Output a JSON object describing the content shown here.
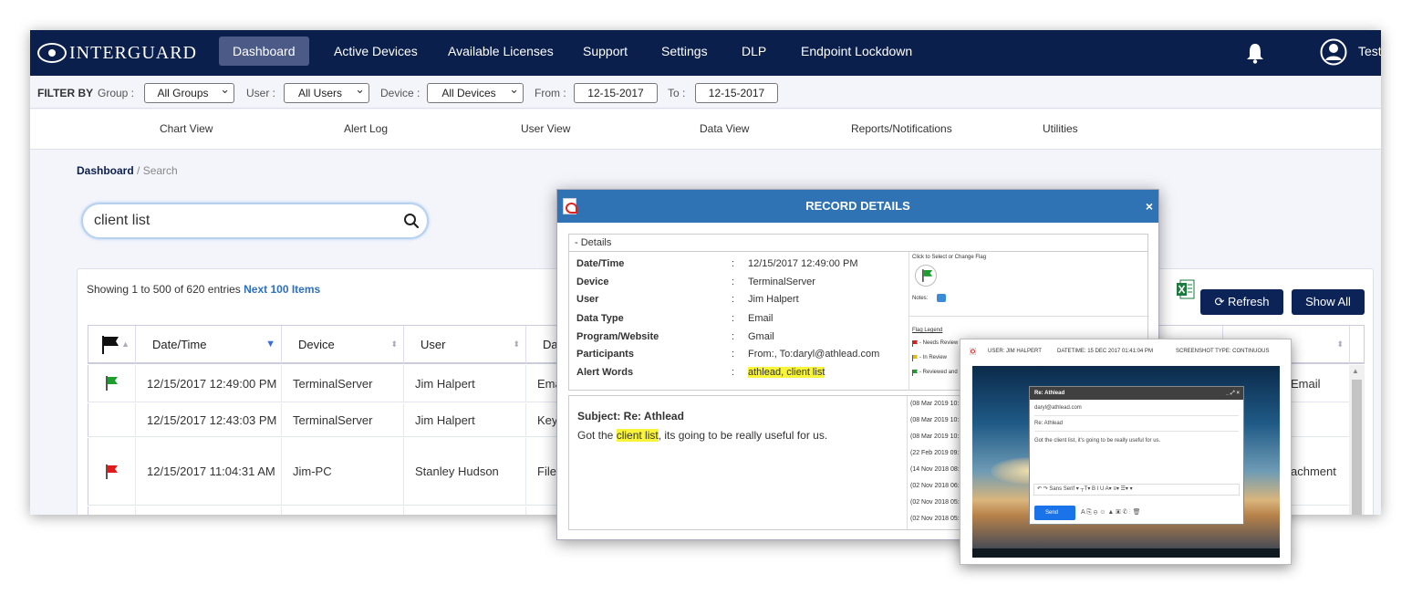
{
  "brand": {
    "name": "INTERGUARD"
  },
  "nav": {
    "items": [
      "Dashboard",
      "Active Devices",
      "Available Licenses",
      "Support",
      "Settings",
      "DLP",
      "Endpoint Lockdown"
    ],
    "user": "Test"
  },
  "filter": {
    "title": "FILTER BY",
    "group_label": "Group :",
    "group_value": "All Groups",
    "user_label": "User :",
    "user_value": "All Users",
    "device_label": "Device :",
    "device_value": "All Devices",
    "from_label": "From :",
    "from_value": "12-15-2017",
    "to_label": "To :",
    "to_value": "12-15-2017"
  },
  "subnav": [
    "Chart View",
    "Alert Log",
    "User View",
    "Data View",
    "Reports/Notifications",
    "Utilities"
  ],
  "breadcrumb": {
    "root": "Dashboard",
    "current": "/ Search"
  },
  "search": {
    "value": "client list"
  },
  "table": {
    "entries_text": "Showing 1 to 500 of 620 entries",
    "next_link": "Next 100 Items",
    "refresh": "Refresh",
    "show_all": "Show All",
    "headers": [
      "Date/Time",
      "Device",
      "User",
      "Dat"
    ],
    "rows": [
      {
        "flag": "green",
        "datetime": "12/15/2017 12:49:00 PM",
        "device": "TerminalServer",
        "user": "Jim Halpert",
        "type": "Ema",
        "extra": "Email"
      },
      {
        "flag": "none",
        "datetime": "12/15/2017 12:43:03 PM",
        "device": "TerminalServer",
        "user": "Jim Halpert",
        "type": "Keys",
        "extra": ""
      },
      {
        "flag": "red",
        "datetime": "12/15/2017 11:04:31 AM",
        "device": "Jim-PC",
        "user": "Stanley Hudson",
        "type": "File T",
        "extra": "achment"
      }
    ],
    "colors": {
      "green": "#1e9e2e",
      "red": "#e01b1b",
      "navy": "#0b1f4d"
    }
  },
  "modal": {
    "title": "RECORD DETAILS",
    "close": "×",
    "details_header": "- Details",
    "fields": [
      {
        "label": "Date/Time",
        "value": "12/15/2017 12:49:00 PM"
      },
      {
        "label": "Device",
        "value": "TerminalServer"
      },
      {
        "label": "User",
        "value": "Jim Halpert"
      },
      {
        "label": "Data Type",
        "value": "Email"
      },
      {
        "label": "Program/Website",
        "value": "Gmail"
      },
      {
        "label": "Participants",
        "value": "From:, To:daryl@athlead.com"
      },
      {
        "label": "Alert Words",
        "value": "athlead, client list"
      }
    ],
    "flag_hint": "Click to Select or Change Flag",
    "notes": "Notes:",
    "legend_title": "Flag Legend",
    "legend": [
      "- Needs Review",
      "- In Review",
      "- Reviewed and"
    ],
    "subject": "Subject: Re: Athlead",
    "message_before": "Got the ",
    "message_highlight": "client list",
    "message_after": ", its going to be really useful for us.",
    "history": [
      "(08 Mar 2019 10:",
      "(08 Mar 2019 10:",
      "(08 Mar 2019 10:",
      "(22 Feb 2019 09:",
      "(14 Nov 2018 08:",
      "(02 Nov 2018 06:",
      "(02 Nov 2018 05:",
      "(02 Nov 2018 05:"
    ]
  },
  "screenshot": {
    "user": "USER: JIM HALPERT",
    "datetime": "DATETIME: 15 DEC 2017 01:41:04 PM",
    "type": "SCREENSHOT TYPE: CONTINUOUS",
    "compose_title": "Re: Athlead",
    "compose_controls": "_ ⤢ ×",
    "to": "daryl@athlead.com",
    "subject": "Re: Athlead",
    "body": "Got the client list, it's going to be really useful for us.",
    "toolbar": "↶  ↷   Sans Serif  ▾  ┬T▾  B  I  U  A▾  ≡▾  ☰▾  ▾",
    "send": "Send",
    "icons": "A   ⎘   ⊖   ☺   ▲   ▣   ✆                    ⋮  🗑"
  }
}
